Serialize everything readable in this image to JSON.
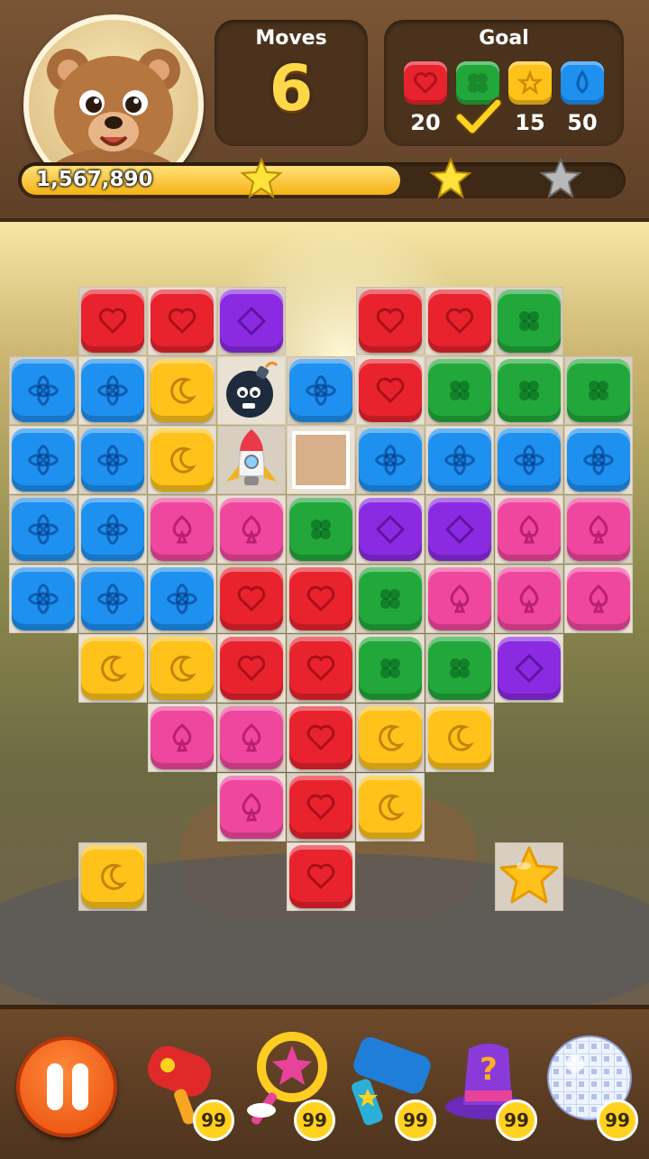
{
  "hud": {
    "moves_label": "Moves",
    "moves_value": "6",
    "goal_label": "Goal",
    "goals": [
      {
        "color": "red",
        "icon": "heart-icon",
        "count": "20"
      },
      {
        "color": "green",
        "icon": "clover-icon",
        "count": "",
        "completed": true
      },
      {
        "color": "yellow",
        "icon": "star-icon",
        "count": "15"
      },
      {
        "color": "blue",
        "icon": "drop-icon",
        "count": "50"
      }
    ],
    "score": "1,567,890",
    "progress_fraction": 0.63,
    "stars_earned": 2,
    "stars_total": 3
  },
  "board": {
    "colors": {
      "red": "#e8232e",
      "purple": "#8a2be2",
      "blue": "#1e90f0",
      "yellow": "#ffc21a",
      "green": "#22a83a",
      "pink": "#f0479e"
    },
    "rows": [
      [
        "",
        "red",
        "red",
        "purple",
        "",
        "red",
        "red",
        "green",
        ""
      ],
      [
        "blue",
        "blue",
        "yellow",
        "bomb",
        "blue",
        "red",
        "green",
        "green",
        "green"
      ],
      [
        "blue",
        "blue",
        "yellow",
        "rocket",
        "empty",
        "blue",
        "blue",
        "blue",
        "blue"
      ],
      [
        "blue",
        "blue",
        "pink",
        "pink",
        "green",
        "purple",
        "purple",
        "pink",
        "pink"
      ],
      [
        "blue",
        "blue",
        "blue",
        "red",
        "red",
        "green",
        "pink",
        "pink",
        "pink"
      ],
      [
        "",
        "yellow",
        "yellow",
        "red",
        "red",
        "green",
        "green",
        "purple",
        ""
      ],
      [
        "",
        "",
        "pink",
        "pink",
        "red",
        "yellow",
        "yellow",
        "",
        ""
      ],
      [
        "",
        "",
        "",
        "pink",
        "red",
        "yellow",
        "",
        "",
        ""
      ],
      [
        "",
        "yellow",
        "",
        "",
        "red",
        "",
        "",
        "star",
        ""
      ]
    ]
  },
  "boosters": [
    {
      "name": "hammer-booster",
      "count": "99"
    },
    {
      "name": "magic-wand-booster",
      "count": "99"
    },
    {
      "name": "mallet-booster",
      "count": "99"
    },
    {
      "name": "mystery-hat-booster",
      "count": "99"
    },
    {
      "name": "disco-ball-booster",
      "count": "99"
    }
  ]
}
